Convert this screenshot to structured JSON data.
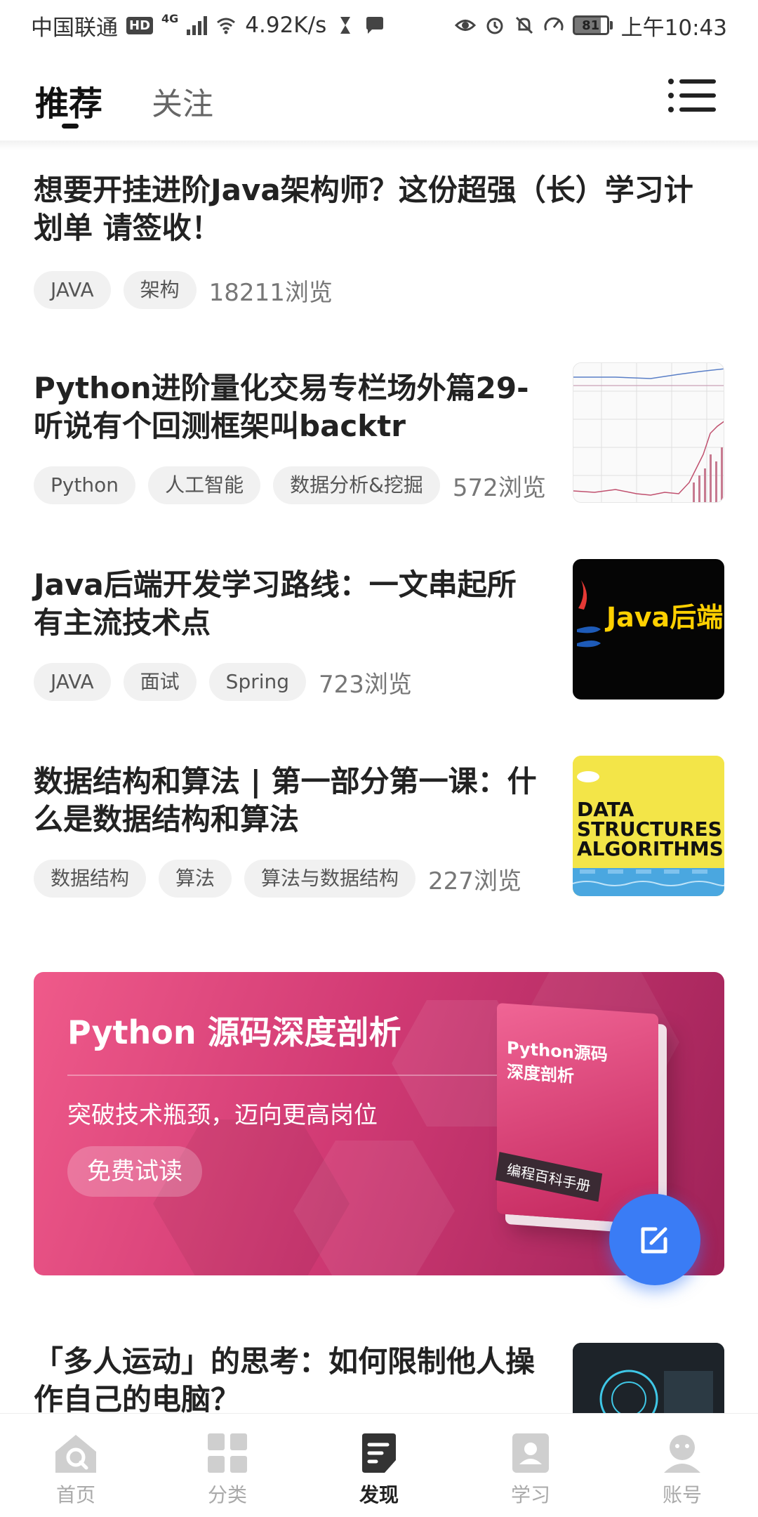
{
  "status_bar": {
    "carrier": "中国联通",
    "hd": "HD",
    "network": "4G",
    "speed": "4.92K/s",
    "battery": "81",
    "time": "上午10:43"
  },
  "header": {
    "tabs": [
      {
        "label": "推荐",
        "active": true
      },
      {
        "label": "关注",
        "active": false
      }
    ]
  },
  "articles": [
    {
      "title": "想要开挂进阶Java架构师？这份超强（长）学习计划单 请签收！",
      "tags": [
        "JAVA",
        "架构"
      ],
      "views": "18211浏览"
    },
    {
      "title": "Python进阶量化交易专栏场外篇29-听说有个回测框架叫backtr",
      "tags": [
        "Python",
        "人工智能",
        "数据分析&挖掘"
      ],
      "views": "572浏览",
      "thumb": "stock-chart"
    },
    {
      "title": "Java后端开发学习路线：一文串起所有主流技术点",
      "tags": [
        "JAVA",
        "面试",
        "Spring"
      ],
      "views": "723浏览",
      "thumb_text": "Java后端 学习路线"
    },
    {
      "title": "数据结构和算法 | 第一部分第一课：什么是数据结构和算法",
      "tags": [
        "数据结构",
        "算法",
        "算法与数据结构"
      ],
      "views": "227浏览",
      "thumb_text": [
        "DATA",
        "STRUCTURES",
        "ALGORITHMS"
      ]
    },
    {
      "title": "「多人运动」的思考：如何限制他人操作自己的电脑？",
      "thumb": "laptop"
    }
  ],
  "banner": {
    "title": "Python 源码深度剖析",
    "subtitle": "突破技术瓶颈，迈向更高岗位",
    "button": "免费试读",
    "book_title_1": "Python源码",
    "book_title_2": "深度剖析",
    "book_tag": "编程百科手册"
  },
  "bottom_nav": [
    {
      "label": "首页",
      "icon": "home-icon",
      "active": false
    },
    {
      "label": "分类",
      "icon": "grid-icon",
      "active": false
    },
    {
      "label": "发现",
      "icon": "discover-icon",
      "active": true
    },
    {
      "label": "学习",
      "icon": "study-icon",
      "active": false
    },
    {
      "label": "账号",
      "icon": "account-icon",
      "active": false
    }
  ],
  "colors": {
    "accent": "#3a7cf5",
    "banner_start": "#ef5a8a",
    "banner_end": "#9e2258"
  }
}
